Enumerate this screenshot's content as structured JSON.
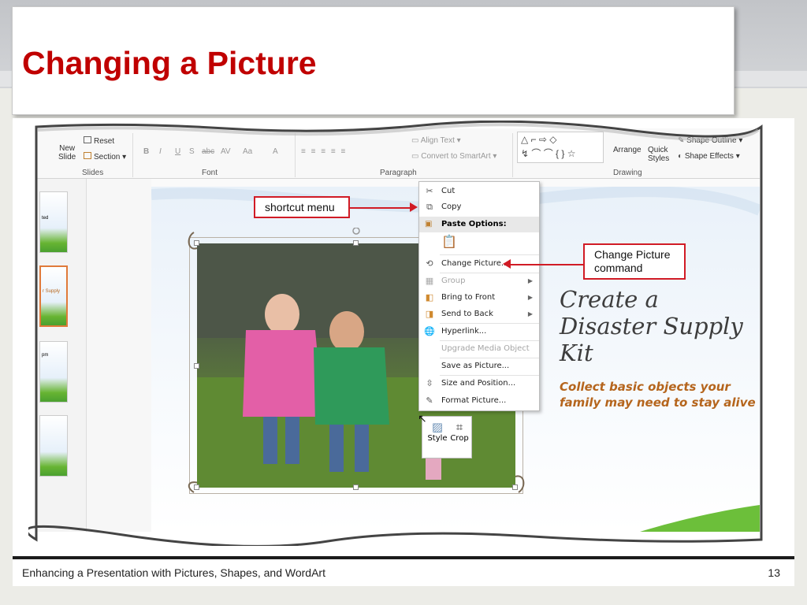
{
  "slide_title": "Changing a Picture",
  "footer": {
    "text": "Enhancing a Presentation with Pictures, Shapes, and WordArt",
    "page": "13"
  },
  "ribbon": {
    "slides_group": {
      "new_slide": "New",
      "new_slide_line2": "Slide",
      "reset": "Reset",
      "section": "Section",
      "label": "Slides"
    },
    "font_group": {
      "bold": "B",
      "italic": "I",
      "underline": "U",
      "shadow": "S",
      "strike": "abc",
      "spacing": "AV",
      "case": "Aa",
      "color": "A",
      "label": "Font"
    },
    "paragraph_group": {
      "align_text": "Align Text",
      "convert_smartart": "Convert to SmartArt",
      "label": "Paragraph"
    },
    "drawing_group": {
      "arrange": "Arrange",
      "quick": "Quick",
      "styles": "Styles",
      "shape_outline": "Shape Outline",
      "shape_effects": "Shape Effects",
      "label": "Drawing"
    }
  },
  "thumbnails": [
    {
      "text": "ted"
    },
    {
      "text": "r Supply"
    },
    {
      "text": "pm"
    },
    {
      "text": ""
    }
  ],
  "slide_content": {
    "title_lines": [
      "Create a",
      "Disaster Supply",
      "Kit"
    ],
    "subtitle_lines": [
      "Collect basic objects your",
      "family may need to stay alive"
    ]
  },
  "context_menu": {
    "cut": "Cut",
    "copy": "Copy",
    "paste_options": "Paste Options:",
    "change_picture": "Change Picture...",
    "group": "Group",
    "bring_to_front": "Bring to Front",
    "send_to_back": "Send to Back",
    "hyperlink": "Hyperlink...",
    "upgrade_media": "Upgrade Media Object",
    "save_as_picture": "Save as Picture...",
    "size_position": "Size and Position...",
    "format_picture": "Format Picture..."
  },
  "mini_toolbar": {
    "style": "Style",
    "crop": "Crop"
  },
  "callouts": {
    "shortcut_menu": "shortcut menu",
    "change_picture_line1": "Change Picture",
    "change_picture_line2": "command"
  },
  "colors": {
    "title_red": "#c00000",
    "callout_red": "#d11b25",
    "slide_text_orange": "#b5651d"
  }
}
